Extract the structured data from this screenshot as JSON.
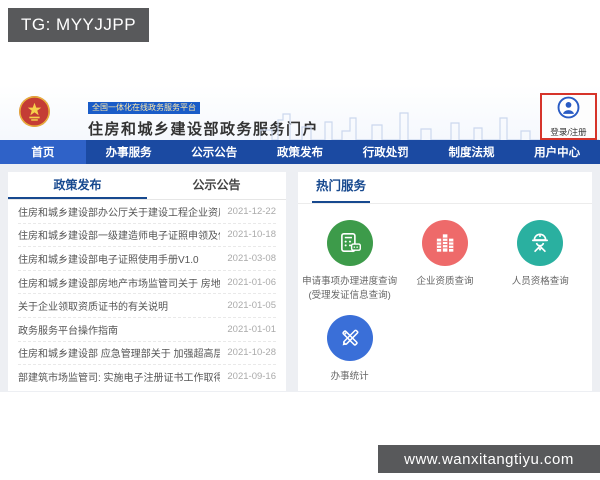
{
  "overlay": {
    "tg_label": "TG: MYYJJPP",
    "watermark": "www.wanxitangtiyu.com"
  },
  "header": {
    "platform_badge": "全国一体化在线政务服务平台",
    "title": "住房和城乡建设部政务服务门户",
    "login_label": "登录/注册"
  },
  "nav": {
    "items": [
      {
        "label": "首页",
        "active": true
      },
      {
        "label": "办事服务",
        "active": false
      },
      {
        "label": "公示公告",
        "active": false
      },
      {
        "label": "政策发布",
        "active": false
      },
      {
        "label": "行政处罚",
        "active": false
      },
      {
        "label": "制度法规",
        "active": false
      },
      {
        "label": "用户中心",
        "active": false
      }
    ]
  },
  "left_panel": {
    "tabs": [
      {
        "label": "政策发布",
        "active": true
      },
      {
        "label": "公示公告",
        "active": false
      }
    ],
    "items": [
      {
        "title": "住房和城乡建设部办公厅关于建设工程企业资质统一延续有关...",
        "date": "2021-12-22"
      },
      {
        "title": "住房和城乡建设部一级建造师电子证照申领及使用手册",
        "date": "2021-10-18"
      },
      {
        "title": "住房和城乡建设部电子证照使用手册V1.0",
        "date": "2021-03-08"
      },
      {
        "title": "住房和城乡建设部房地产市场监管司关于 房地产开发企业一级...",
        "date": "2021-01-06"
      },
      {
        "title": "关于企业领取资质证书的有关说明",
        "date": "2021-01-05"
      },
      {
        "title": "政务服务平台操作指南",
        "date": "2021-01-01"
      },
      {
        "title": "住房和城乡建设部  应急管理部关于 加强超高层建筑规划建设...",
        "date": "2021-10-28"
      },
      {
        "title": "部建筑市场监管司: 实施电子注册证书工作取得初步进展",
        "date": "2021-09-16"
      }
    ]
  },
  "hot_services": {
    "title": "热门服务",
    "items": [
      {
        "label": "申请事项办理进度查询",
        "sublabel": "(受理发证信息查询)",
        "color": "#3d9b4a",
        "icon": "calculator-icon"
      },
      {
        "label": "企业资质查询",
        "sublabel": "",
        "color": "#ee6a6a",
        "icon": "building-icon"
      },
      {
        "label": "人员资格查询",
        "sublabel": "",
        "color": "#2ab0a0",
        "icon": "worker-icon"
      },
      {
        "label": "办事统计",
        "sublabel": "",
        "color": "#3a6fd8",
        "icon": "statistics-icon"
      }
    ]
  },
  "colors": {
    "nav_bg": "#1b4aa2",
    "nav_active_bg": "#2f62c8",
    "accent_blue": "#17498f",
    "annotation_red": "#d6342a",
    "overlay_gray": "#58595b"
  }
}
